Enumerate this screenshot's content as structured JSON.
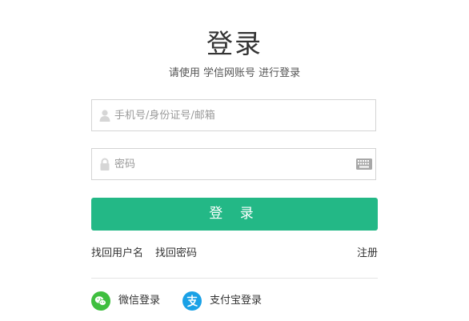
{
  "header": {
    "title": "登录",
    "subtitle": "请使用 学信网账号 进行登录"
  },
  "form": {
    "username_placeholder": "手机号/身份证号/邮箱",
    "username_value": "",
    "password_placeholder": "密码",
    "password_value": "",
    "login_label": "登 录"
  },
  "links": {
    "forgot_username": "找回用户名",
    "forgot_password": "找回密码",
    "register": "注册"
  },
  "third_party": {
    "wechat_label": "微信登录",
    "alipay_label": "支付宝登录"
  },
  "colors": {
    "primary": "#23b886",
    "wechat": "#3fbf3f",
    "alipay": "#1aa1e6"
  }
}
